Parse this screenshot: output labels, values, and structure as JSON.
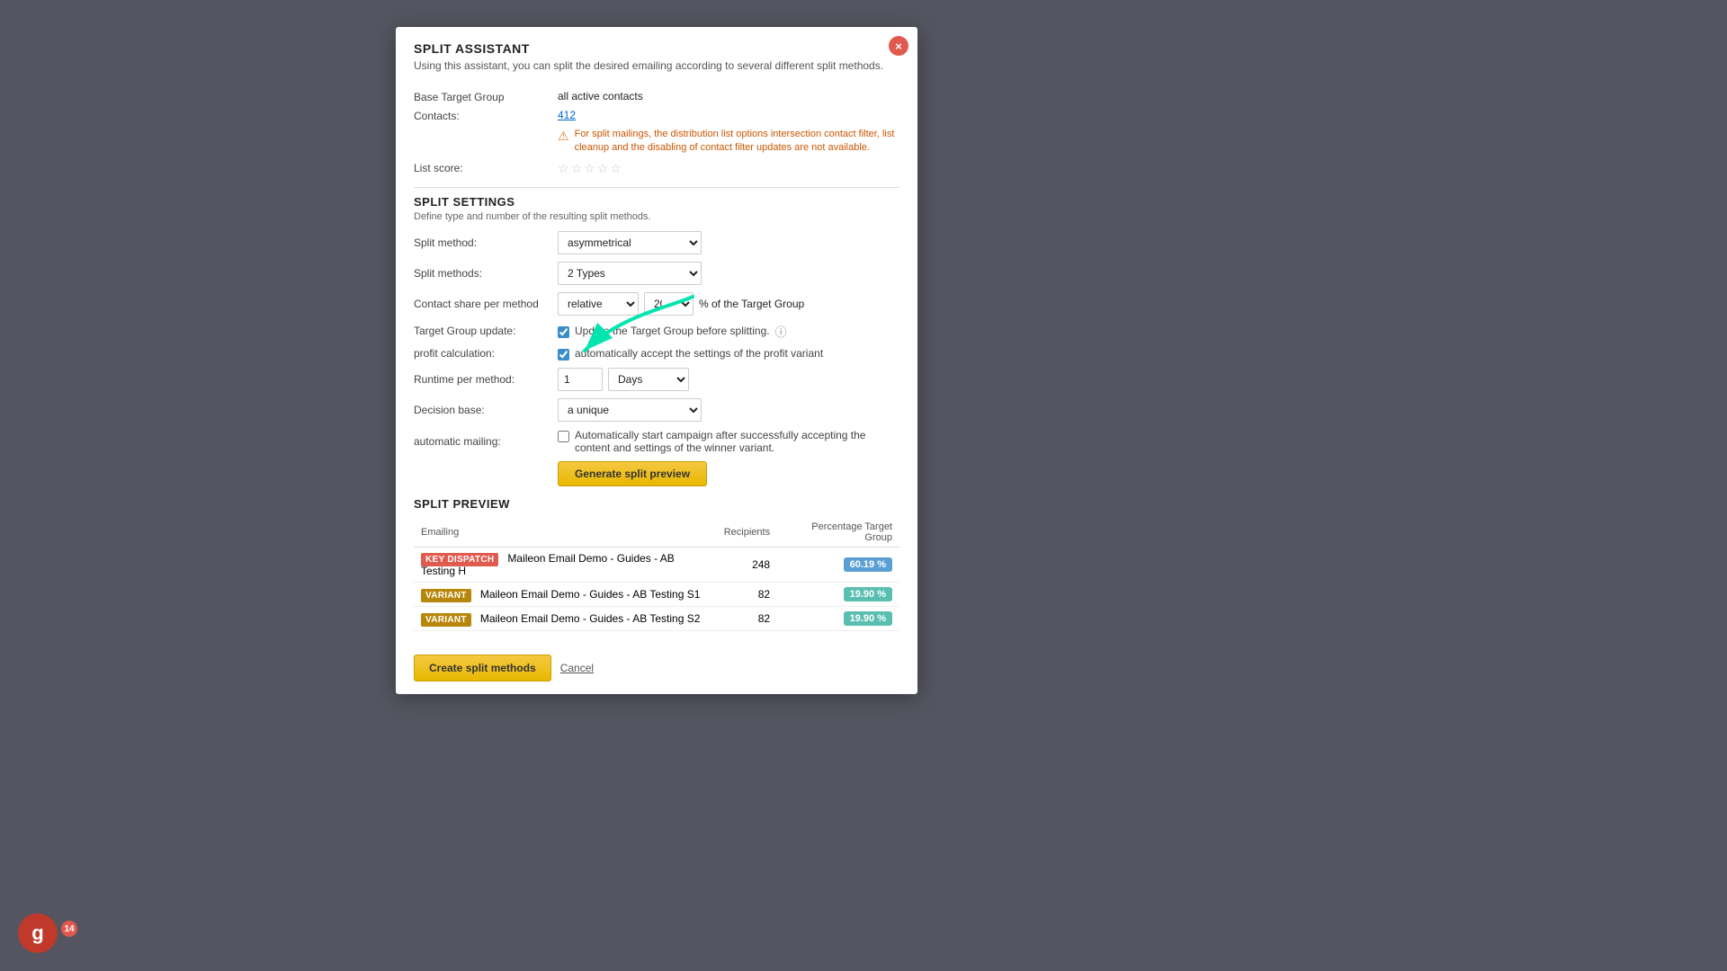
{
  "modal": {
    "title": "SPLIT ASSISTANT",
    "subtitle": "Using this assistant, you can split the desired emailing according to several different split methods.",
    "close_label": "×"
  },
  "info": {
    "base_target_group_label": "Base Target Group",
    "base_target_group_value": "all active contacts",
    "contacts_label": "Contacts:",
    "contacts_value": "412",
    "warning_text": "For split mailings, the distribution list options intersection contact filter, list cleanup and the disabling of contact filter updates are not available.",
    "list_score_label": "List score:"
  },
  "split_settings": {
    "section_title": "SPLIT SETTINGS",
    "section_desc": "Define type and number of the resulting split methods.",
    "split_method_label": "Split method:",
    "split_method_value": "asymmetrical",
    "split_methods_label": "Split methods:",
    "split_methods_value": "2 Types",
    "contact_share_label": "Contact share per method",
    "contact_share_type": "relative",
    "contact_share_value": "20",
    "contact_share_suffix": "% of the Target Group",
    "target_group_update_label": "Target Group update:",
    "target_group_update_checked": true,
    "target_group_update_text": "Update the Target Group before splitting.",
    "profit_calc_label": "profit calculation:",
    "profit_calc_checked": true,
    "profit_calc_text": "automatically accept the settings of the profit variant",
    "runtime_label": "Runtime per method:",
    "runtime_value": "1",
    "runtime_unit": "Days",
    "decision_base_label": "Decision base:",
    "decision_base_value": "a unique",
    "auto_mailing_label": "automatic mailing:",
    "auto_mailing_checked": false,
    "auto_mailing_text": "Automatically start campaign after successfully accepting the content and settings of the winner variant."
  },
  "generate_btn_label": "Generate split preview",
  "split_preview": {
    "section_title": "SPLIT PREVIEW",
    "columns": {
      "emailing": "Emailing",
      "recipients": "Recipients",
      "pct_target": "Percentage Target Group"
    },
    "rows": [
      {
        "badge": "KEY DISPATCH",
        "badge_type": "dispatch",
        "name": "Maileon Email Demo - Guides - AB Testing H",
        "recipients": "248",
        "pct": "60.19 %",
        "pct_type": "blue"
      },
      {
        "badge": "VARIANT",
        "badge_type": "variant",
        "name": "Maileon Email Demo - Guides - AB Testing S1",
        "recipients": "82",
        "pct": "19.90 %",
        "pct_type": "teal"
      },
      {
        "badge": "VARIANT",
        "badge_type": "variant",
        "name": "Maileon Email Demo - Guides - AB Testing S2",
        "recipients": "82",
        "pct": "19.90 %",
        "pct_type": "teal"
      }
    ]
  },
  "footer": {
    "create_btn": "Create split methods",
    "cancel_btn": "Cancel"
  },
  "avatar": {
    "letter": "g",
    "badge_count": "14"
  }
}
